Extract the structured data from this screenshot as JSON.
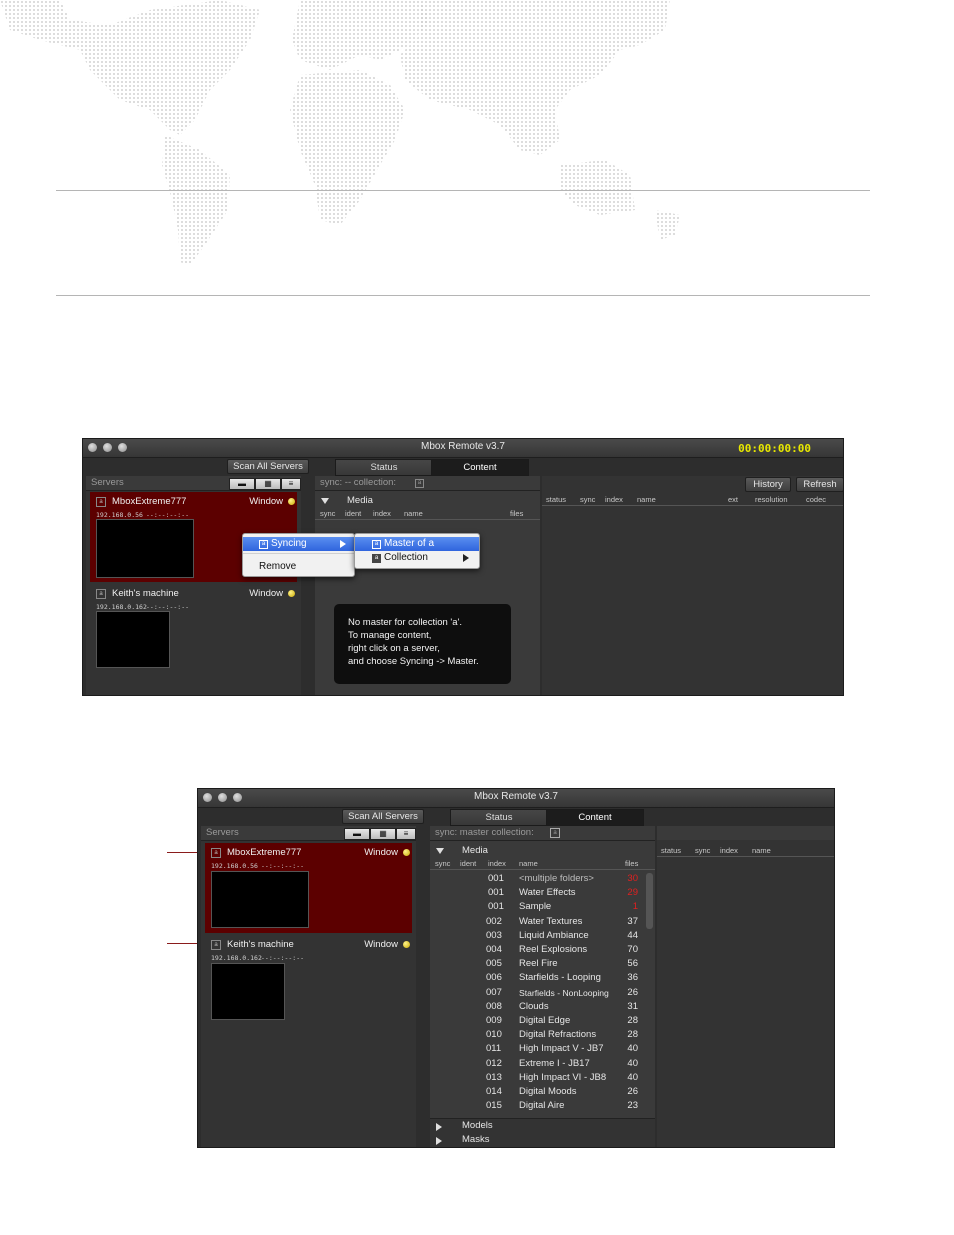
{
  "window1": {
    "title": "Mbox Remote v3.7",
    "timecode": "00:00:00:00",
    "scan_button": "Scan All Servers",
    "tabs": [
      "Status",
      "Content"
    ],
    "servers_label": "Servers",
    "sync_line": "sync: -- collection:",
    "collection_badge": "a",
    "history_button": "History",
    "refresh_button": "Refresh",
    "media_label": "Media",
    "media_columns": [
      "sync",
      "ident",
      "index",
      "name",
      "files"
    ],
    "right_columns": [
      "status",
      "sync",
      "index",
      "name",
      "ext",
      "resolution",
      "codec"
    ],
    "servers": [
      {
        "badge": "a",
        "name": "MboxExtreme777",
        "ip": "192.168.0.56",
        "ip_status": "--:--:--:--",
        "window_label": "Window"
      },
      {
        "badge": "a",
        "name": "Keith's machine",
        "ip": "192.168.0.162",
        "ip_status": "--:--:--:--",
        "window_label": "Window"
      }
    ],
    "context_menu": {
      "badge": "a",
      "items": [
        "Syncing",
        "Remove"
      ],
      "submenu": [
        "Master of a",
        "Collection"
      ],
      "submenu_badges": [
        "a",
        "a"
      ]
    },
    "tooltip_lines": [
      "No master for collection 'a'.",
      "To manage content,",
      "right click on a server,",
      "and choose Syncing -> Master."
    ]
  },
  "window2": {
    "title": "Mbox Remote v3.7",
    "scan_button": "Scan All Servers",
    "tabs": [
      "Status",
      "Content"
    ],
    "servers_label": "Servers",
    "sync_line": "sync: master collection:",
    "collection_badge": "a",
    "media_label": "Media",
    "media_columns": [
      "sync",
      "ident",
      "index",
      "name",
      "files"
    ],
    "right_columns": [
      "status",
      "sync",
      "index",
      "name"
    ],
    "servers": [
      {
        "badge": "a",
        "name": "MboxExtreme777",
        "ip": "192.168.0.56",
        "ip_status": "--:--:--:--",
        "window_label": "Window"
      },
      {
        "badge": "a",
        "name": "Keith's machine",
        "ip": "192.168.0.162",
        "ip_status": "--:--:--:--",
        "window_label": "Window"
      }
    ],
    "media_rows": [
      {
        "index": "001",
        "name": "<multiple folders>",
        "files": "30",
        "conflict": true
      },
      {
        "index": "001",
        "name": "Water Effects",
        "files": "29",
        "conflict": true
      },
      {
        "index": "001",
        "name": "Sample",
        "files": "1",
        "conflict": true
      },
      {
        "index": "002",
        "name": "Water Textures",
        "files": "37",
        "conflict": false
      },
      {
        "index": "003",
        "name": "Liquid Ambiance",
        "files": "44",
        "conflict": false
      },
      {
        "index": "004",
        "name": "Reel Explosions",
        "files": "70",
        "conflict": false
      },
      {
        "index": "005",
        "name": "Reel Fire",
        "files": "56",
        "conflict": false
      },
      {
        "index": "006",
        "name": "Starfields - Looping",
        "files": "36",
        "conflict": false
      },
      {
        "index": "007",
        "name": "Starfields - NonLooping",
        "files": "26",
        "conflict": false
      },
      {
        "index": "008",
        "name": "Clouds",
        "files": "31",
        "conflict": false
      },
      {
        "index": "009",
        "name": "Digital Edge",
        "files": "28",
        "conflict": false
      },
      {
        "index": "010",
        "name": "Digital Refractions",
        "files": "28",
        "conflict": false
      },
      {
        "index": "011",
        "name": "High Impact V - JB7",
        "files": "40",
        "conflict": false
      },
      {
        "index": "012",
        "name": "Extreme I - JB17",
        "files": "40",
        "conflict": false
      },
      {
        "index": "013",
        "name": "High Impact VI - JB8",
        "files": "40",
        "conflict": false
      },
      {
        "index": "014",
        "name": "Digital Moods",
        "files": "26",
        "conflict": false
      },
      {
        "index": "015",
        "name": "Digital Aire",
        "files": "23",
        "conflict": false
      }
    ],
    "collapsed_groups": [
      "Models",
      "Masks"
    ]
  },
  "colors": {
    "selected_server": "#5c0000",
    "window_bg": "#2d2d2d",
    "conflict": "#e02020",
    "timecode": "#e8e800",
    "callout_line": "#8a1c1c"
  }
}
